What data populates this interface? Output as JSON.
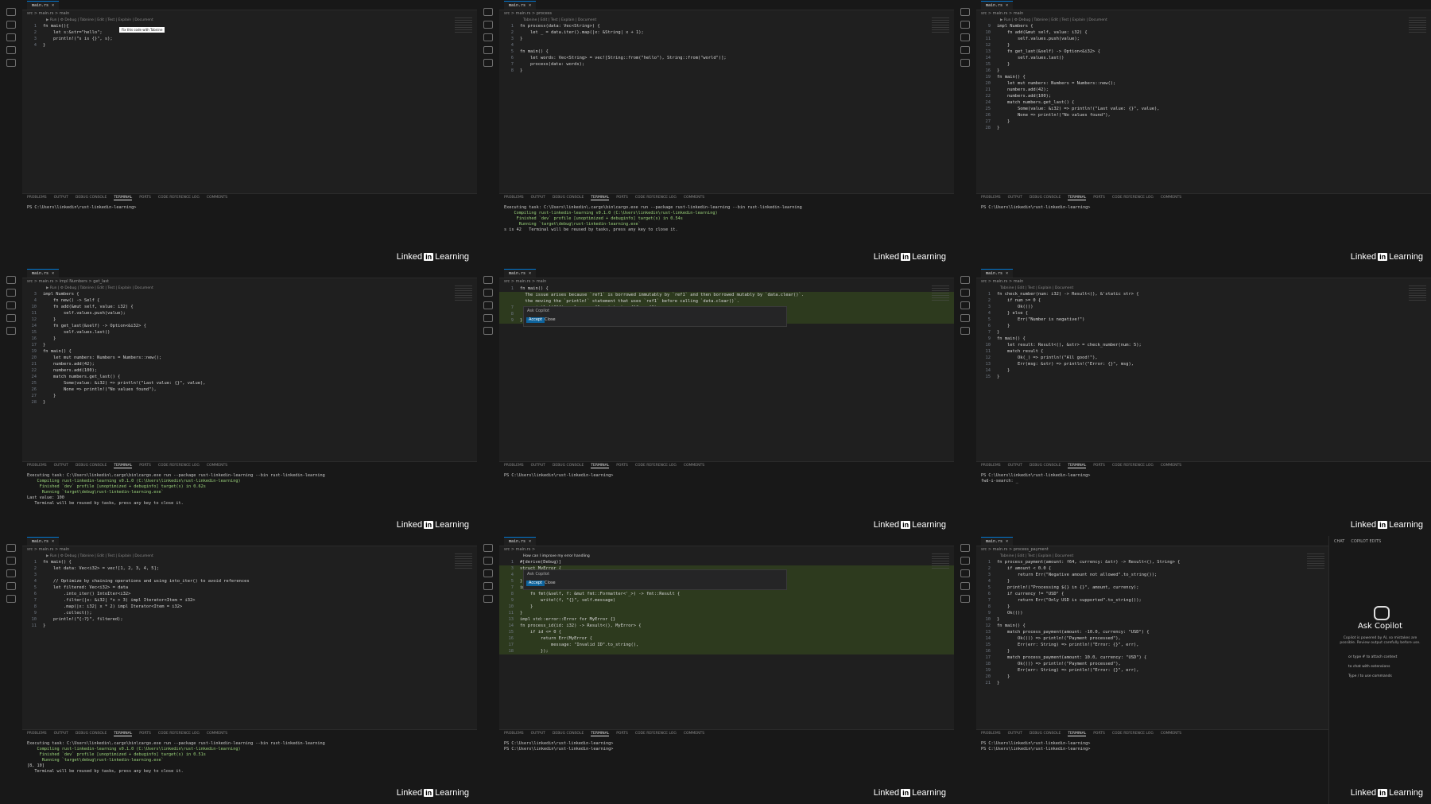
{
  "brand": {
    "name_left": "Linked",
    "name_in": "in",
    "name_right": " Learning"
  },
  "tiles": [
    {
      "tab": "main.rs",
      "crumb": "src > main.rs > main",
      "lens": "▶ Run | ⚙ Debug | Tabnine | Edit | Test | Explain | Document",
      "tooltip": "Fix this code with Tabnine",
      "lines": [
        [
          "1",
          "fn main(){"
        ],
        [
          "2",
          "    let s:&str=\"hello\";"
        ],
        [
          "3",
          "    println!(\"s is {}\", s);"
        ],
        [
          "4",
          "}"
        ]
      ],
      "panel_tabs": [
        "PROBLEMS",
        "OUTPUT",
        "DEBUG CONSOLE",
        "TERMINAL",
        "PORTS",
        "CODE REFERENCE LOG",
        "COMMENTS"
      ],
      "terminal": [
        "PS C:\\Users\\linkedin\\rust-linkedin-learning> "
      ]
    },
    {
      "tab": "main.rs",
      "crumb": "src > main.rs > process",
      "lens": "Tabnine | Edit | Test | Explain | Document",
      "lines": [
        [
          "1",
          "fn process(data: Vec<String>) {"
        ],
        [
          "2",
          "    let _ = data.iter().map(|x: &String| x + 1);"
        ],
        [
          "3",
          "}"
        ],
        [
          "4",
          ""
        ],
        [
          "5",
          "fn main() {"
        ],
        [
          "6",
          "    let words: Vec<String> = vec![String::from(\"hello\"), String::from(\"world\")];"
        ],
        [
          "7",
          "    process(data: words);"
        ],
        [
          "8",
          "}"
        ]
      ],
      "panel_tabs": [
        "PROBLEMS",
        "OUTPUT",
        "DEBUG CONSOLE",
        "TERMINAL",
        "PORTS",
        "CODE REFERENCE LOG",
        "COMMENTS"
      ],
      "terminal": [
        "Executing task: C:\\Users\\linkedin\\.cargo\\bin\\cargo.exe run --package rust-linkedin-learning --bin rust-linkedin-learning",
        "",
        "    Compiling rust-linkedin-learning v0.1.0 (C:\\Users\\linkedin\\rust-linkedin-learning)",
        "     Finished `dev` profile [unoptimized + debuginfo] target(s) in 0.54s",
        "      Running `target\\debug\\rust-linkedin-learning.exe`",
        "s is 42   Terminal will be reused by tasks, press any key to close it."
      ]
    },
    {
      "tab": "main.rs",
      "crumb": "src > main.rs > main",
      "lens": "▶ Run | ⚙ Debug | Tabnine | Edit | Test | Explain | Document",
      "lines": [
        [
          "9",
          "impl Numbers {"
        ],
        [
          "10",
          "    fn add(&mut self, value: i32) {"
        ],
        [
          "11",
          "        self.values.push(value);"
        ],
        [
          "12",
          "    }"
        ],
        [
          "13",
          "    fn get_last(&self) -> Option<&i32> {"
        ],
        [
          "14",
          "        self.values.last()"
        ],
        [
          "15",
          "    }"
        ],
        [
          "16",
          "}"
        ],
        [
          "19",
          "fn main() {"
        ],
        [
          "20",
          "    let mut numbers: Numbers = Numbers::new();"
        ],
        [
          "21",
          "    numbers.add(42);"
        ],
        [
          "22",
          "    numbers.add(100);"
        ],
        [
          "24",
          "    match numbers.get_last() {"
        ],
        [
          "25",
          "        Some(value: &i32) => println!(\"Last value: {}\", value),"
        ],
        [
          "26",
          "        None => println!(\"No values found\"),"
        ],
        [
          "27",
          "    }"
        ],
        [
          "28",
          "}"
        ]
      ],
      "panel_tabs": [
        "PROBLEMS",
        "OUTPUT",
        "DEBUG CONSOLE",
        "TERMINAL",
        "PORTS",
        "CODE REFERENCE LOG",
        "COMMENTS"
      ],
      "terminal": [
        "PS C:\\Users\\linkedin\\rust-linkedin-learning> "
      ]
    },
    {
      "tab": "main.rs",
      "crumb": "src > main.rs > impl Numbers > get_last",
      "lens": "▶ Run | ⚙ Debug | Tabnine | Edit | Test | Explain | Document",
      "lines": [
        [
          "3",
          "impl Numbers {"
        ],
        [
          "4",
          "    fn new() -> Self {"
        ],
        [
          "10",
          "    fn add(&mut self, value: i32) {"
        ],
        [
          "11",
          "        self.values.push(value);"
        ],
        [
          "12",
          "    }"
        ],
        [
          "14",
          "    fn get_last(&self) -> Option<&i32> {"
        ],
        [
          "15",
          "        self.values.last()"
        ],
        [
          "16",
          "    }"
        ],
        [
          "17",
          "}"
        ],
        [
          "19",
          "fn main() {"
        ],
        [
          "20",
          "    let mut numbers: Numbers = Numbers::new();"
        ],
        [
          "21",
          "    numbers.add(42);"
        ],
        [
          "22",
          "    numbers.add(100);"
        ],
        [
          "24",
          "    match numbers.get_last() {"
        ],
        [
          "25",
          "        Some(value: &i32) => println!(\"Last value: {}\", value),"
        ],
        [
          "26",
          "        None => println!(\"No values found\"),"
        ],
        [
          "27",
          "    }"
        ],
        [
          "28",
          "}"
        ]
      ],
      "panel_tabs": [
        "PROBLEMS",
        "OUTPUT",
        "DEBUG CONSOLE",
        "TERMINAL",
        "PORTS",
        "CODE REFERENCE LOG",
        "COMMENTS"
      ],
      "terminal": [
        "Executing task: C:\\Users\\linkedin\\.cargo\\bin\\cargo.exe run --package rust-linkedin-learning --bin rust-linkedin-learning",
        "",
        "    Compiling rust-linkedin-learning v0.1.0 (C:\\Users\\linkedin\\rust-linkedin-learning)",
        "     Finished `dev` profile [unoptimized + debuginfo] target(s) in 0.62s",
        "      Running `target\\debug\\rust-linkedin-learning.exe`",
        "Last value: 100",
        "   Terminal will be reused by tasks, press any key to close it."
      ]
    },
    {
      "tab": "main.rs",
      "crumb": "src > main.rs > main",
      "lens": "",
      "lines": [
        [
          "1",
          "fn main() {"
        ],
        [
          "",
          "  The issue arises because `ref1` is borrowed immutably by `ref1` and then borrowed mutably by `data.clear()`."
        ],
        [
          "",
          "  the moving the `println!` statement that uses `ref1` before calling `data.clear()`."
        ],
        [
          "7",
          "    println!(\"After clear, ref1 points to: {}\", ref1);"
        ],
        [
          "8",
          "    data.clear();"
        ],
        [
          "9",
          "}"
        ]
      ],
      "copilot": {
        "placeholder": "Ask Copilot",
        "accept": "Accept",
        "close": "Close"
      },
      "panel_tabs": [
        "PROBLEMS",
        "OUTPUT",
        "DEBUG CONSOLE",
        "TERMINAL",
        "PORTS",
        "CODE REFERENCE LOG",
        "COMMENTS"
      ],
      "terminal": [
        "PS C:\\Users\\linkedin\\rust-linkedin-learning> "
      ]
    },
    {
      "tab": "main.rs",
      "crumb": "src > main.rs > main",
      "lens": "Tabnine | Edit | Test | Explain | Document",
      "lines": [
        [
          "1",
          "fn check_number(num: i32) -> Result<(), &'static str> {"
        ],
        [
          "2",
          "    if num >= 0 {"
        ],
        [
          "3",
          "        Ok(())"
        ],
        [
          "4",
          "    } else {"
        ],
        [
          "5",
          "        Err(\"Number is negative!\")"
        ],
        [
          "6",
          "    }"
        ],
        [
          "7",
          "}"
        ],
        [
          "9",
          "fn main() {"
        ],
        [
          "10",
          "    let result: Result<(), &str> = check_number(num: 5);"
        ],
        [
          "11",
          "    match result {"
        ],
        [
          "12",
          "        Ok(_) => println!(\"All good!\"),"
        ],
        [
          "13",
          "        Err(msg: &str) => println!(\"Error: {}\", msg),"
        ],
        [
          "14",
          "    }"
        ],
        [
          "15",
          "}"
        ]
      ],
      "panel_tabs": [
        "PROBLEMS",
        "OUTPUT",
        "DEBUG CONSOLE",
        "TERMINAL",
        "PORTS",
        "CODE REFERENCE LOG",
        "COMMENTS"
      ],
      "terminal": [
        "PS C:\\Users\\linkedin\\rust-linkedin-learning> ",
        "fwd-i-search: _"
      ]
    },
    {
      "tab": "main.rs",
      "crumb": "src > main.rs > main",
      "lens": "▶ Run | ⚙ Debug | Tabnine | Edit | Test | Explain | Document",
      "lines": [
        [
          "1",
          "fn main() {"
        ],
        [
          "2",
          "    let data: Vec<i32> = vec![1, 2, 3, 4, 5];"
        ],
        [
          "3",
          ""
        ],
        [
          "4",
          "    // Optimize by chaining operations and using into_iter() to avoid references"
        ],
        [
          "5",
          "    let filtered: Vec<i32> = data"
        ],
        [
          "6",
          "        .into_iter() IntoIter<i32>"
        ],
        [
          "7",
          "        .filter(|x: &i32| *x > 3) impl Iterator<Item = i32>"
        ],
        [
          "8",
          "        .map(|x: i32| x * 2) impl Iterator<Item = i32>"
        ],
        [
          "9",
          "        .collect();"
        ],
        [
          "10",
          "    println!(\"{:?}\", filtered);"
        ],
        [
          "11",
          "}"
        ]
      ],
      "panel_tabs": [
        "PROBLEMS",
        "OUTPUT",
        "DEBUG CONSOLE",
        "TERMINAL",
        "PORTS",
        "CODE REFERENCE LOG",
        "COMMENTS"
      ],
      "terminal": [
        "Executing task: C:\\Users\\linkedin\\.cargo\\bin\\cargo.exe run --package rust-linkedin-learning --bin rust-linkedin-learning",
        "",
        "    Compiling rust-linkedin-learning v0.1.0 (C:\\Users\\linkedin\\rust-linkedin-learning)",
        "     Finished `dev` profile [unoptimized + debuginfo] target(s) in 0.51s",
        "      Running `target\\debug\\rust-linkedin-learning.exe`",
        "[8, 10]",
        "   Terminal will be reused by tasks, press any key to close it."
      ]
    },
    {
      "tab": "main.rs",
      "crumb": "src > main.rs > ",
      "lens": "",
      "prompt": "How can I improve my error handling",
      "lines": [
        [
          "1",
          "#[derive(Debug)]"
        ],
        [
          "3",
          "struct MyError {"
        ],
        [
          "4",
          "    message: String,"
        ],
        [
          "5",
          "}"
        ],
        [
          "7",
          "impl fmt::Display for MyError {"
        ],
        [
          "8",
          "    fn fmt(&self, f: &mut fmt::Formatter<'_>) -> fmt::Result {"
        ],
        [
          "9",
          "        write!(f, \"{}\", self.message)"
        ],
        [
          "10",
          "    }"
        ],
        [
          "11",
          "}"
        ],
        [
          "13",
          "impl std::error::Error for MyError {}"
        ],
        [
          "14",
          "fn process_id(id: i32) -> Result<(), MyError> {"
        ],
        [
          "15",
          "    if id <= 0 {"
        ],
        [
          "16",
          "        return Err(MyError {"
        ],
        [
          "17",
          "            message: \"Invalid ID\".to_string(),"
        ],
        [
          "18",
          "        });"
        ]
      ],
      "copilot": {
        "placeholder": "Ask Copilot",
        "accept": "Accept",
        "close": "Close"
      },
      "panel_tabs": [
        "PROBLEMS",
        "OUTPUT",
        "DEBUG CONSOLE",
        "TERMINAL",
        "PORTS",
        "CODE REFERENCE LOG",
        "COMMENTS"
      ],
      "terminal": [
        "PS C:\\Users\\linkedin\\rust-linkedin-learning> ",
        "PS C:\\Users\\linkedin\\rust-linkedin-learning> "
      ]
    },
    {
      "tab": "main.rs",
      "crumb": "src > main.rs > process_payment",
      "lens": "Tabnine | Edit | Test | Explain | Document",
      "lines": [
        [
          "1",
          "fn process_payment(amount: f64, currency: &str) -> Result<(), String> {"
        ],
        [
          "2",
          "    if amount < 0.0 {"
        ],
        [
          "3",
          "        return Err(\"Negative amount not allowed\".to_string());"
        ],
        [
          "4",
          "    }"
        ],
        [
          "5",
          "    println!(\"Processing ${} in {}\", amount, currency);"
        ],
        [
          "6",
          "    if currency != \"USD\" {"
        ],
        [
          "7",
          "        return Err(\"Only USD is supported\".to_string());"
        ],
        [
          "8",
          "    }"
        ],
        [
          "9",
          "    Ok(())"
        ],
        [
          "10",
          "}"
        ],
        [
          "12",
          "fn main() {"
        ],
        [
          "13",
          "    match process_payment(amount: -10.0, currency: \"USD\") {"
        ],
        [
          "14",
          "        Ok(()) => println!(\"Payment processed\"),"
        ],
        [
          "15",
          "        Err(err: String) => println!(\"Error: {}\", err),"
        ],
        [
          "16",
          "    }"
        ],
        [
          "17",
          "    match process_payment(amount: 10.0, currency: \"USD\") {"
        ],
        [
          "18",
          "        Ok(()) => println!(\"Payment processed\"),"
        ],
        [
          "19",
          "        Err(err: String) => println!(\"Error: {}\", err),"
        ],
        [
          "20",
          "    }"
        ],
        [
          "21",
          "}"
        ]
      ],
      "chat": {
        "tab_chat": "CHAT",
        "tab_edits": "COPILOT EDITS",
        "title": "Ask Copilot",
        "desc": "Copilot is powered by AI, so mistakes are possible. Review output carefully before use.",
        "hint1": "or type # to attach context",
        "hint2": "to chat with extensions",
        "hint3": "Type / to use commands"
      },
      "panel_tabs": [
        "PROBLEMS",
        "OUTPUT",
        "DEBUG CONSOLE",
        "TERMINAL",
        "PORTS",
        "CODE REFERENCE LOG",
        "COMMENTS"
      ],
      "terminal": [
        "PS C:\\Users\\linkedin\\rust-linkedin-learning> ",
        "PS C:\\Users\\linkedin\\rust-linkedin-learning> "
      ]
    }
  ]
}
